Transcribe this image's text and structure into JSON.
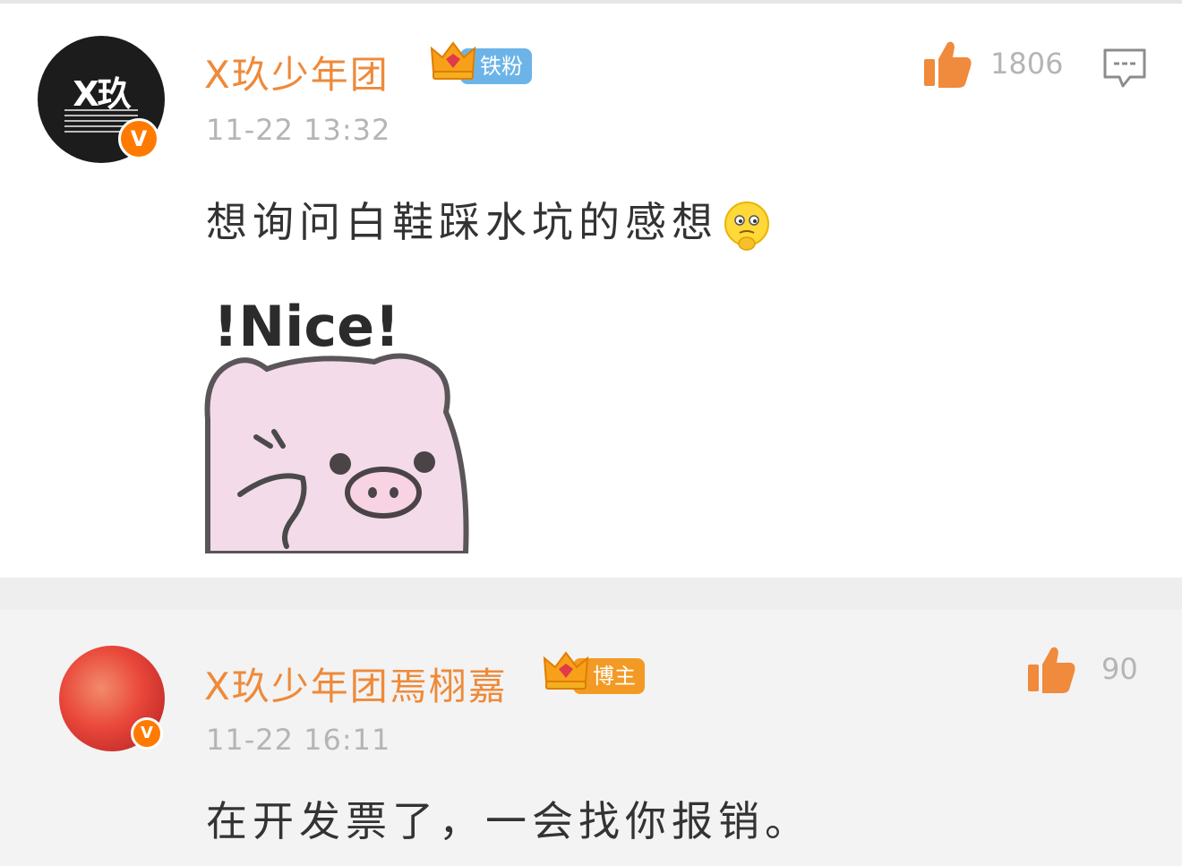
{
  "comments": [
    {
      "avatar_text": "X玖",
      "verified_mark": "V",
      "username": "X玖少年团",
      "badge_label": "铁粉",
      "badge_color": "#6cb4e8",
      "timestamp": "11-22 13:32",
      "text": "想询问白鞋踩水坑的感想",
      "emoji": "thinking-emoji",
      "sticker_caption": "!Nice!",
      "like_count": "1806"
    },
    {
      "verified_mark": "V",
      "username": "X玖少年团焉栩嘉",
      "badge_label": "博主",
      "badge_color": "#f29a24",
      "timestamp": "11-22 16:11",
      "text": "在开发票了，一会找你报销。",
      "like_count": "90"
    }
  ],
  "colors": {
    "username": "#ee8a3a",
    "timestamp": "#b5b5b5",
    "like_icon": "#f08a3c",
    "verified": "#ff7a00"
  }
}
